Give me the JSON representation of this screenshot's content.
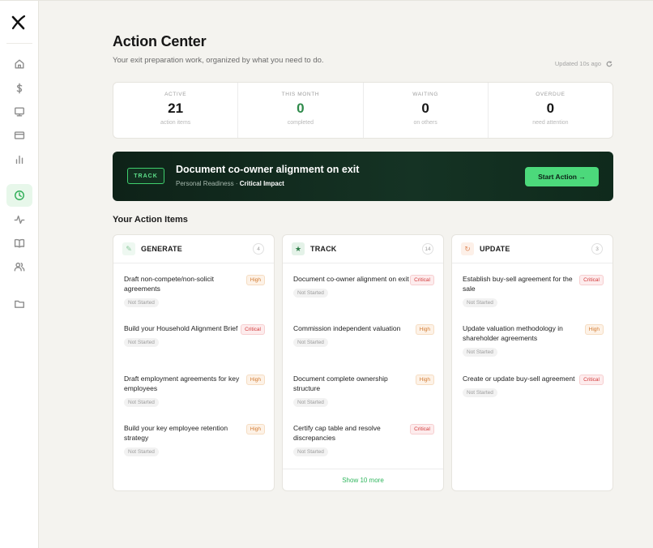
{
  "header": {
    "title": "Action Center",
    "subtitle": "Your exit preparation work, organized by what you need to do.",
    "updated": "Updated 10s ago"
  },
  "stats": [
    {
      "label": "ACTIVE",
      "value": "21",
      "sub": "action items"
    },
    {
      "label": "THIS MONTH",
      "value": "0",
      "sub": "completed"
    },
    {
      "label": "WAITING",
      "value": "0",
      "sub": "on others"
    },
    {
      "label": "OVERDUE",
      "value": "0",
      "sub": "need attention"
    }
  ],
  "banner": {
    "tag": "TRACK",
    "title": "Document co-owner alignment on exit",
    "meta_prefix": "Personal Readiness · ",
    "meta_impact": "Critical Impact",
    "button": "Start Action →"
  },
  "section_title": "Your Action Items",
  "columns": [
    {
      "name": "GENERATE",
      "count": "4",
      "icon": "✎",
      "icon_color": "#8cc99e",
      "icon_bg": "#eef8f1",
      "tasks": [
        {
          "title": "Draft non-compete/non-solicit agreements",
          "priority": "High",
          "status": "Not Started"
        },
        {
          "title": "Build your Household Alignment Brief",
          "priority": "Critical",
          "status": "Not Started"
        },
        {
          "title": "Draft employment agreements for key employees",
          "priority": "High",
          "status": "Not Started"
        },
        {
          "title": "Build your key employee retention strategy",
          "priority": "High",
          "status": "Not Started"
        }
      ]
    },
    {
      "name": "TRACK",
      "count": "14",
      "icon": "★",
      "icon_color": "#2f7d4a",
      "icon_bg": "#e4f2e8",
      "tasks": [
        {
          "title": "Document co-owner alignment on exit",
          "priority": "Critical",
          "status": "Not Started"
        },
        {
          "title": "Commission independent valuation",
          "priority": "High",
          "status": "Not Started"
        },
        {
          "title": "Document complete ownership structure",
          "priority": "High",
          "status": "Not Started"
        },
        {
          "title": "Certify cap table and resolve discrepancies",
          "priority": "Critical",
          "status": "Not Started"
        }
      ],
      "footer": "Show 10 more"
    },
    {
      "name": "UPDATE",
      "count": "3",
      "icon": "↻",
      "icon_color": "#e08f63",
      "icon_bg": "#fdf0e8",
      "tasks": [
        {
          "title": "Establish buy-sell agreement for the sale",
          "priority": "Critical",
          "status": "Not Started"
        },
        {
          "title": "Update valuation methodology in shareholder agreements",
          "priority": "High",
          "status": "Not Started"
        },
        {
          "title": "Create or update buy-sell agreement",
          "priority": "Critical",
          "status": "Not Started"
        }
      ]
    }
  ],
  "colors": {
    "accent": "#4cd97b",
    "banner_bg": "#0e2218",
    "high": "#d27b32",
    "critical": "#d13a3a"
  },
  "nav_icons": [
    "home-icon",
    "dollar-icon",
    "monitor-icon",
    "card-icon",
    "bar-chart-icon",
    "clock-icon",
    "activity-icon",
    "book-icon",
    "users-icon",
    "folder-icon"
  ]
}
